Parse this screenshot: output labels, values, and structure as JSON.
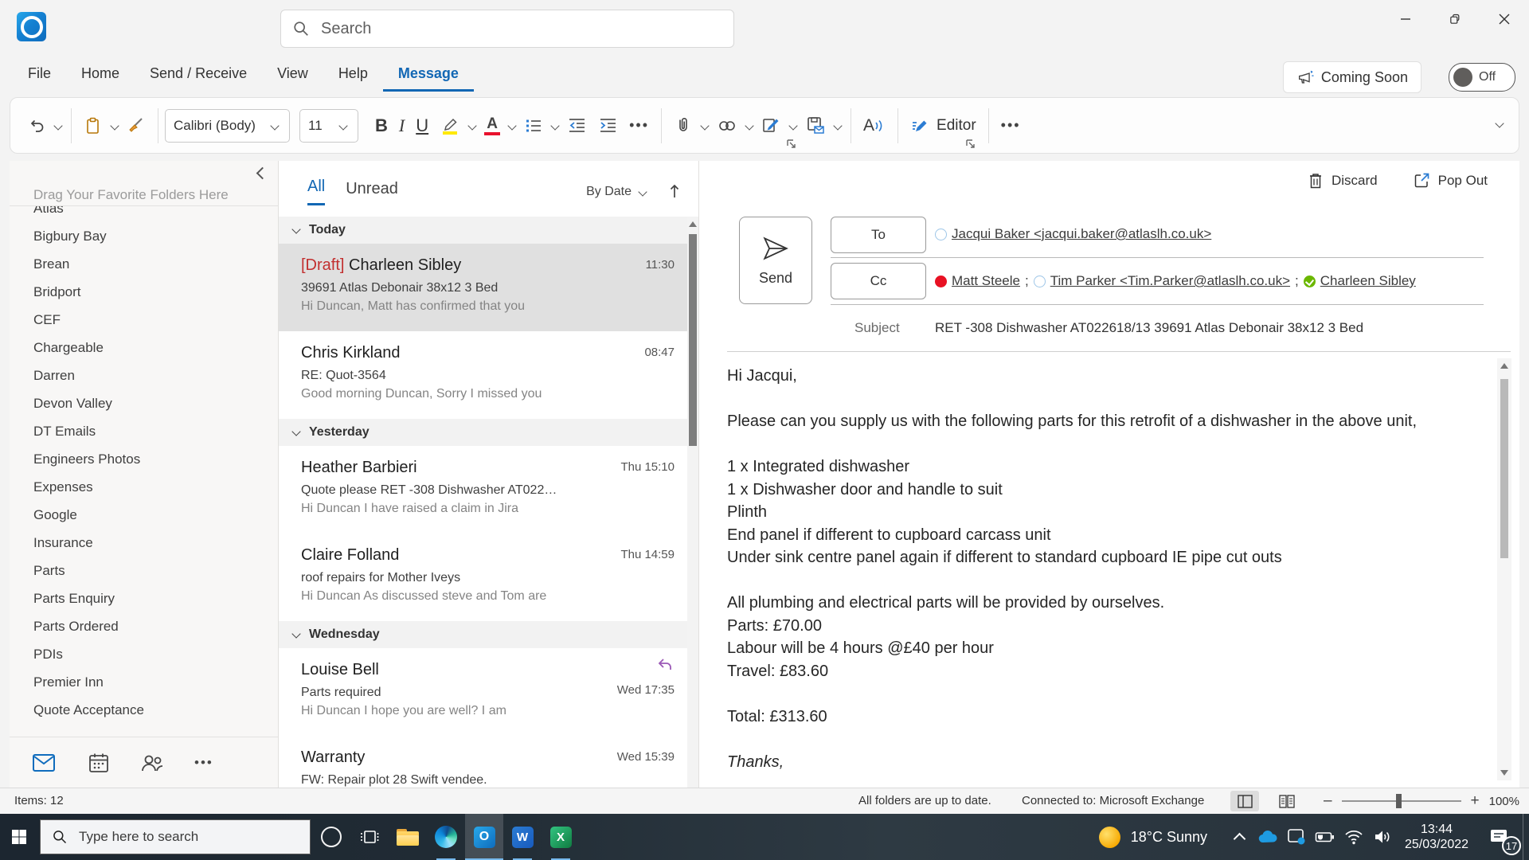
{
  "titlebar": {
    "search_placeholder": "Search"
  },
  "menu": {
    "items": [
      "File",
      "Home",
      "Send / Receive",
      "View",
      "Help",
      "Message"
    ],
    "coming_soon": "Coming Soon",
    "toggle": "Off"
  },
  "ribbon": {
    "font_name": "Calibri (Body)",
    "font_size": "11",
    "bold": "B",
    "italic": "I",
    "underline": "U",
    "font_color_glyph": "A",
    "read_aloud_glyph": "A",
    "editor": "Editor",
    "more1": "•••",
    "more2": "•••"
  },
  "sidebar": {
    "hint": "Drag Your Favorite Folders Here",
    "folders": [
      "Atlas",
      "Bigbury Bay",
      "Brean",
      "Bridport",
      "CEF",
      "Chargeable",
      "Darren",
      "Devon Valley",
      "DT Emails",
      "Engineers Photos",
      "Expenses",
      "Google",
      "Insurance",
      "Parts",
      "Parts Enquiry",
      "Parts Ordered",
      "PDIs",
      "Premier Inn",
      "Quote Acceptance"
    ],
    "more": "•••"
  },
  "list": {
    "tab_all": "All",
    "tab_unread": "Unread",
    "sort": "By Date",
    "groups": [
      "Today",
      "Yesterday",
      "Wednesday"
    ],
    "emails": [
      {
        "draft": "[Draft]",
        "sender": "Charleen Sibley",
        "subject": "39691 Atlas Debonair 38x12 3 Bed",
        "preview": "Hi Duncan,  Matt has confirmed that you",
        "time": "11:30"
      },
      {
        "sender": "Chris Kirkland",
        "subject": "RE: Quot-3564",
        "preview": "Good morning Duncan,  Sorry I missed you",
        "time": "08:47"
      },
      {
        "sender": "Heather Barbieri",
        "subject": "Quote please  RET -308 Dishwasher  AT022…",
        "preview": "Hi Duncan  I have raised a claim in Jira",
        "time": "Thu 15:10"
      },
      {
        "sender": "Claire Folland",
        "subject": "roof repairs for Mother Iveys",
        "preview": "Hi Duncan  As discussed steve and Tom are",
        "time": "Thu 14:59"
      },
      {
        "sender": "Louise Bell",
        "subject": "Parts required",
        "preview": "Hi Duncan  I hope you are well?  I am",
        "time": "Wed 17:35"
      },
      {
        "sender": "Warranty",
        "subject": "FW: Repair plot 28 Swift vendee.",
        "preview": "",
        "time": "Wed 15:39"
      }
    ]
  },
  "compose": {
    "discard": "Discard",
    "popout": "Pop Out",
    "send": "Send",
    "to_label": "To",
    "cc_label": "Cc",
    "subject_label": "Subject",
    "to1": "Jacqui Baker <jacqui.baker@atlaslh.co.uk>",
    "cc1": "Matt Steele",
    "cc2": "Tim Parker <Tim.Parker@atlaslh.co.uk>",
    "cc3": "Charleen Sibley",
    "sep1": ";",
    "sep2": ";",
    "subject": "RET -308 Dishwasher  AT022618/13 39691 Atlas Debonair 38x12 3 Bed",
    "body": [
      "Hi Jacqui,",
      "",
      "Please can you supply us with the following parts for this retrofit of a dishwasher in the above unit,",
      "",
      "1 x Integrated dishwasher",
      "1 x Dishwasher door and handle to suit",
      "Plinth",
      "End panel if different to cupboard carcass unit",
      "Under sink centre panel again if different to standard cupboard IE pipe cut outs",
      "",
      "All plumbing and electrical parts will be provided by ourselves.",
      "Parts: £70.00",
      "Labour will be 4 hours @£40 per hour",
      "Travel: £83.60",
      "",
      "Total: £313.60",
      "",
      "Thanks,"
    ]
  },
  "statusbar": {
    "items": "Items: 12",
    "sync": "All folders are up to date.",
    "connection": "Connected to: Microsoft Exchange",
    "zoom_out": "–",
    "zoom_in": "+",
    "zoom": "100%"
  },
  "taskbar": {
    "search_placeholder": "Type here to search",
    "weather": "18°C  Sunny",
    "time": "13:44",
    "date": "25/03/2022",
    "notifications": "17",
    "glyph_outlook": "O",
    "glyph_word": "W",
    "glyph_excel": "X"
  }
}
